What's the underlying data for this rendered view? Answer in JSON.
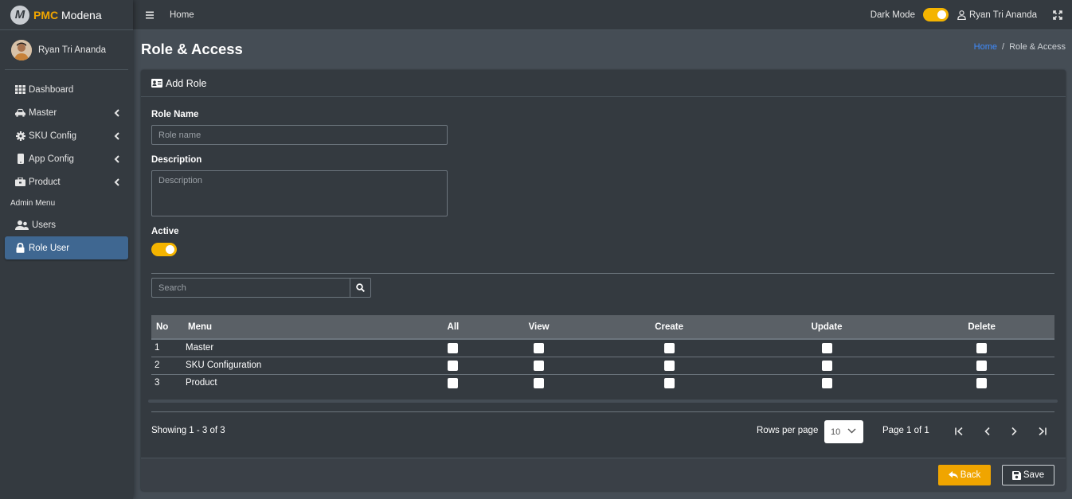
{
  "brand": {
    "strong": "PMC",
    "rest": " Modena",
    "logo_letter": "M"
  },
  "user": {
    "name": "Ryan Tri Ananda"
  },
  "sidebar": {
    "items": [
      {
        "label": "Dashboard",
        "icon": "grid-icon"
      },
      {
        "label": "Master",
        "icon": "car-icon",
        "has_children": true
      },
      {
        "label": "SKU Config",
        "icon": "gear-icon",
        "has_children": true
      },
      {
        "label": "App Config",
        "icon": "mobile-icon",
        "has_children": true
      },
      {
        "label": "Product",
        "icon": "toolbox-icon",
        "has_children": true
      }
    ],
    "admin_header": "Admin Menu",
    "admin_items": [
      {
        "label": "Users",
        "icon": "users-icon"
      },
      {
        "label": "Role User",
        "icon": "lock-icon",
        "active": true
      }
    ]
  },
  "navbar": {
    "home": "Home",
    "dark_mode_label": "Dark Mode",
    "dark_mode_on": true,
    "user_name": "Ryan Tri Ananda"
  },
  "page": {
    "title": "Role & Access",
    "breadcrumb": {
      "home": "Home",
      "current": "Role & Access"
    }
  },
  "card": {
    "header": "Add Role"
  },
  "form": {
    "role_name_label": "Role Name",
    "role_name_placeholder": "Role name",
    "role_name_value": "",
    "description_label": "Description",
    "description_placeholder": "Description",
    "description_value": "",
    "active_label": "Active",
    "active_on": true
  },
  "search": {
    "placeholder": "Search",
    "value": ""
  },
  "table": {
    "columns": [
      "No",
      "Menu",
      "All",
      "View",
      "Create",
      "Update",
      "Delete"
    ],
    "rows": [
      {
        "no": "1",
        "menu": "Master"
      },
      {
        "no": "2",
        "menu": "SKU Configuration"
      },
      {
        "no": "3",
        "menu": "Product"
      }
    ]
  },
  "pagination": {
    "showing": "Showing 1 - 3 of 3",
    "rows_per_page_label": "Rows per page",
    "rows_per_page": "10",
    "page_info": "Page 1 of 1"
  },
  "footer": {
    "back_label": "Back",
    "save_label": "Save"
  },
  "colors": {
    "accent": "#f0a500",
    "active_nav": "#3f6791",
    "link": "#3f8cff"
  }
}
